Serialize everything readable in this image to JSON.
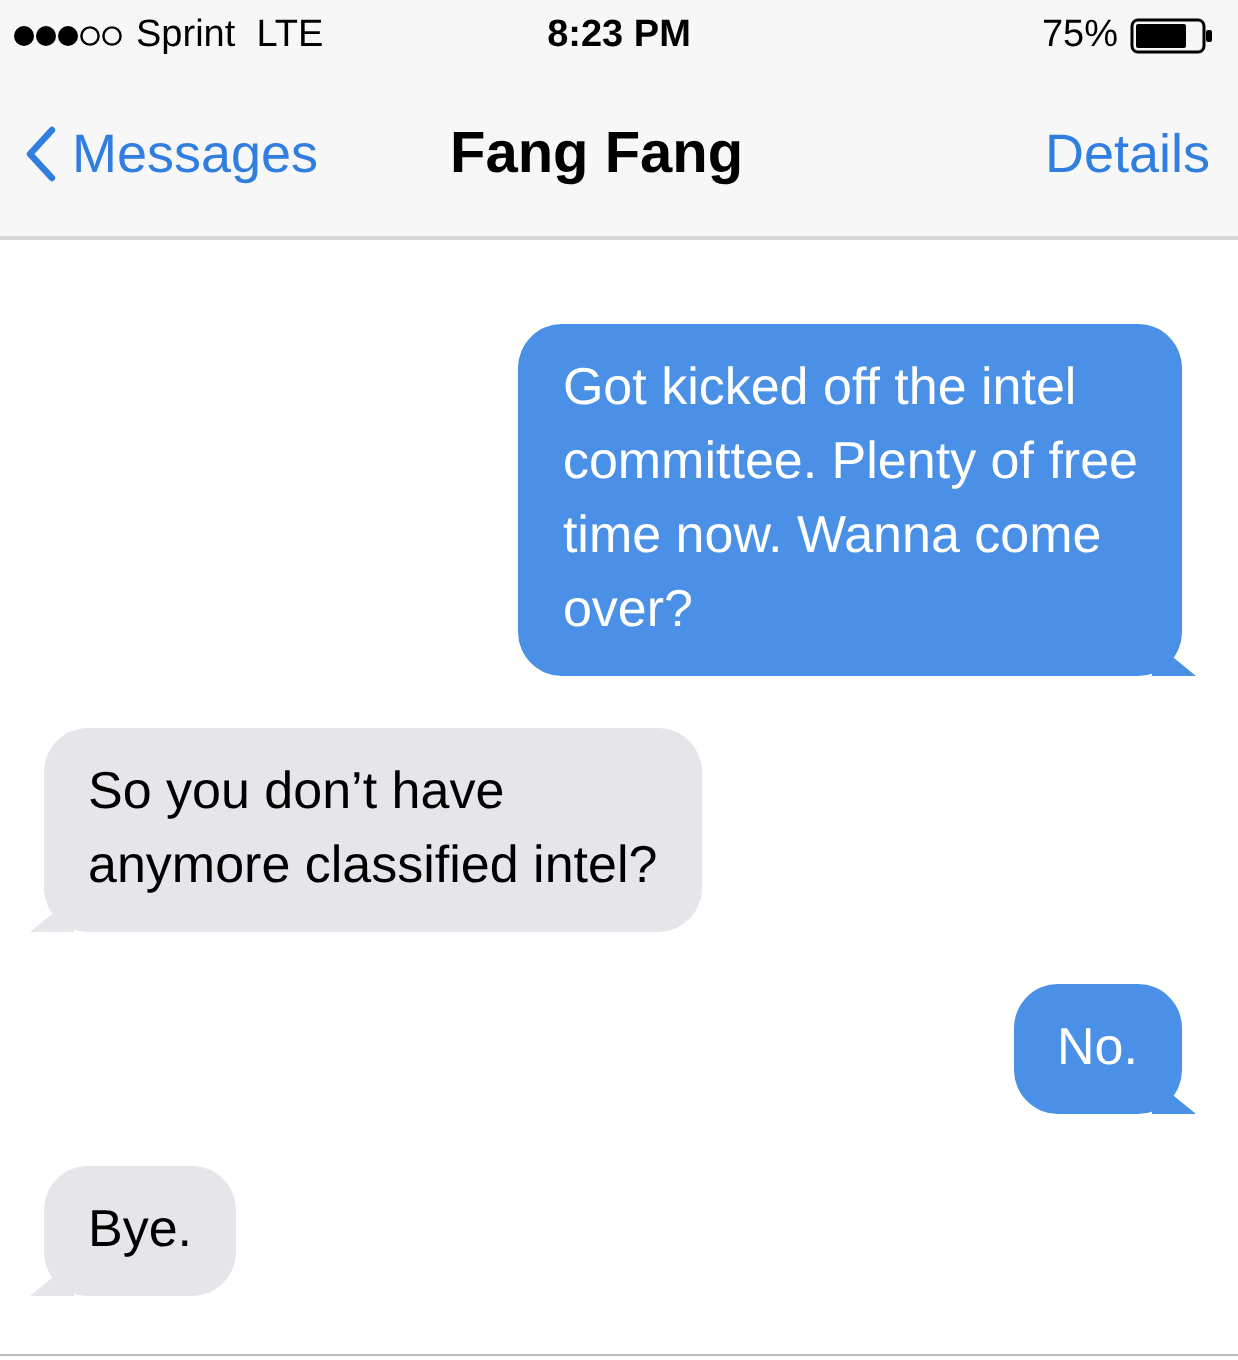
{
  "status_bar": {
    "carrier": "Sprint  LTE",
    "time": "8:23 PM",
    "battery": "75%"
  },
  "nav_bar": {
    "back": "Messages",
    "title": "Fang Fang",
    "action": "Details"
  },
  "messages": [
    {
      "kind": "sent",
      "text": "Got kicked off the intel\ncommittee. Plenty of free\ntime now. Wanna come\nover?"
    },
    {
      "kind": "received",
      "text": "So you don’t have\nanymore classified intel?"
    },
    {
      "kind": "sent",
      "text": "No."
    },
    {
      "kind": "received",
      "text": "Bye."
    }
  ]
}
